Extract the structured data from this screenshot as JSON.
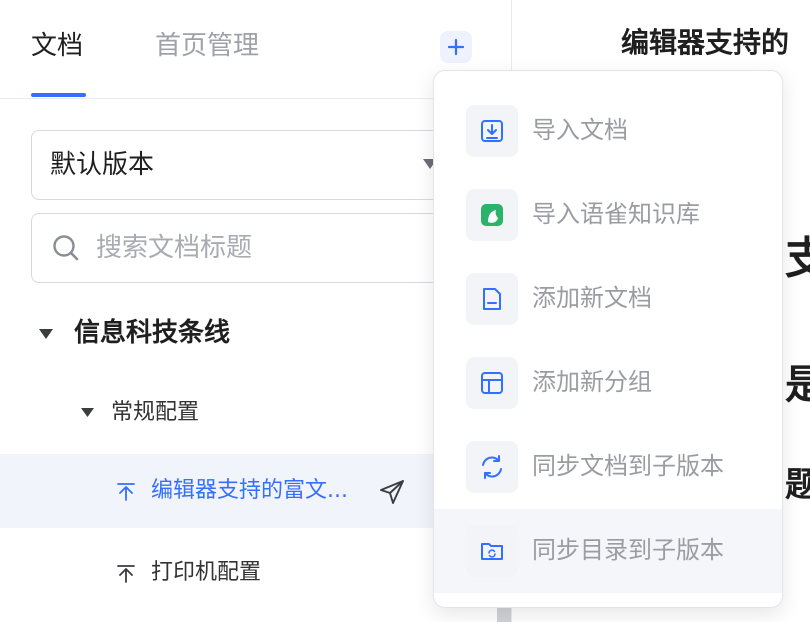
{
  "tabs": {
    "docs": "文档",
    "home_mgmt": "首页管理"
  },
  "version_select": {
    "value": "默认版本"
  },
  "search": {
    "placeholder": "搜索文档标题"
  },
  "tree": {
    "root": "信息科技条线",
    "group": "常规配置",
    "active_doc": "编辑器支持的富文...",
    "other_doc": "打印机配置"
  },
  "editor": {
    "title": "编辑器支持的",
    "glyphs": [
      "支",
      "是",
      "题"
    ]
  },
  "menu": {
    "items": [
      {
        "label": "导入文档",
        "icon": "import-doc-icon"
      },
      {
        "label": "导入语雀知识库",
        "icon": "yuque-icon"
      },
      {
        "label": "添加新文档",
        "icon": "new-doc-icon"
      },
      {
        "label": "添加新分组",
        "icon": "new-group-icon"
      },
      {
        "label": "同步文档到子版本",
        "icon": "sync-icon"
      },
      {
        "label": "同步目录到子版本",
        "icon": "sync-folder-icon"
      }
    ]
  },
  "colors": {
    "accent": "#3370ff",
    "active_row": "#f2f4fb",
    "yuque": "#2bb36b"
  }
}
